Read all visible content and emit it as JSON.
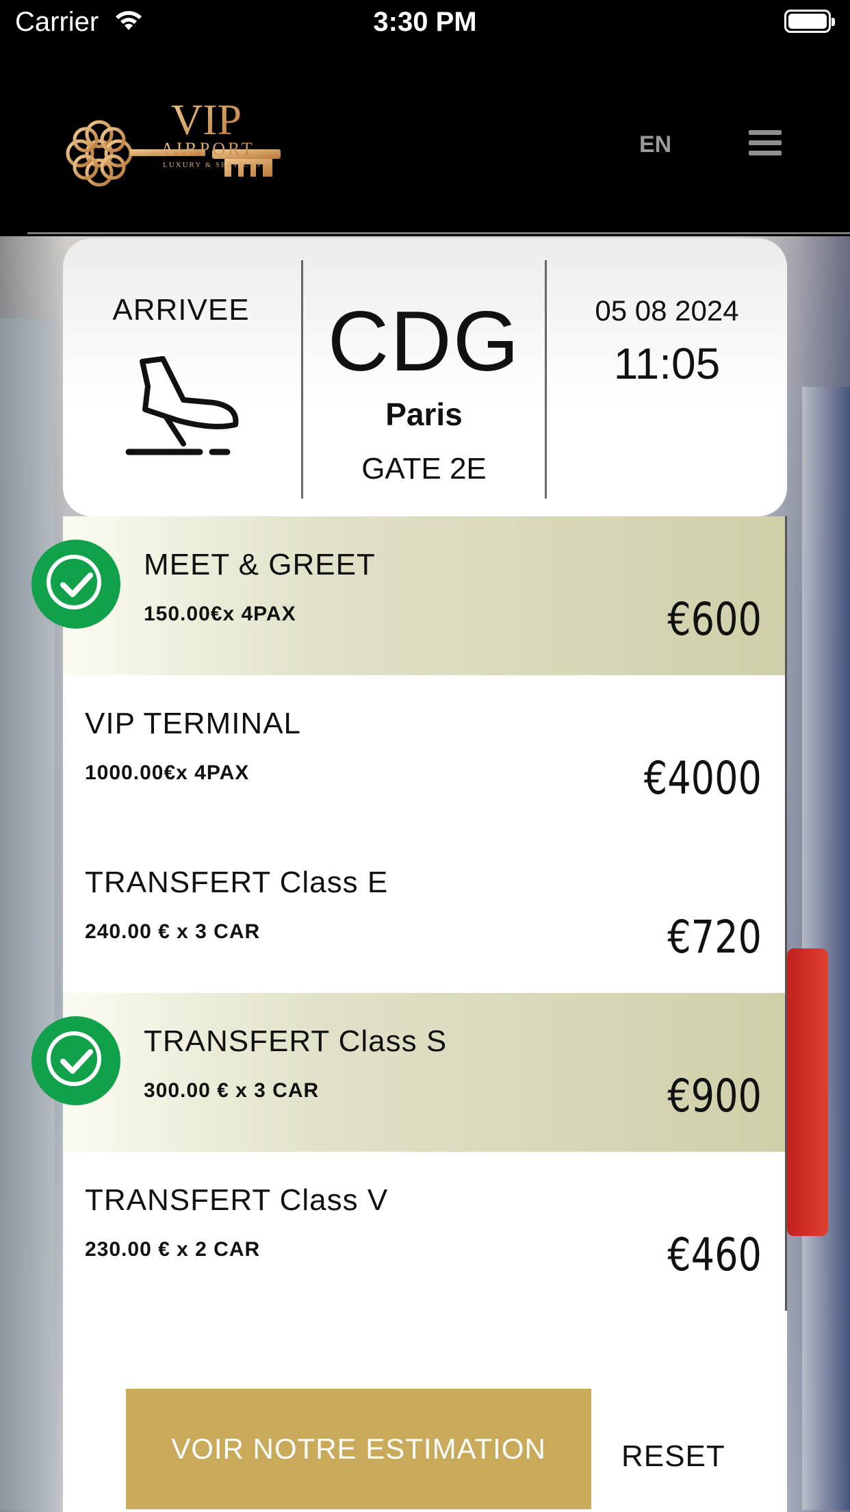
{
  "status_bar": {
    "carrier": "Carrier",
    "time": "3:30 PM"
  },
  "header": {
    "language": "EN"
  },
  "flight": {
    "direction": "ARRIVEE",
    "airport_code": "CDG",
    "city": "Paris",
    "gate": "GATE 2E",
    "date": "05 08 2024",
    "time": "11:05"
  },
  "services": [
    {
      "name": "MEET & GREET",
      "detail": "150.00€x 4PAX",
      "price": "€600",
      "selected": true
    },
    {
      "name": "VIP TERMINAL",
      "detail": "1000.00€x 4PAX",
      "price": "€4000",
      "selected": false
    },
    {
      "name": "TRANSFERT Class E",
      "detail": "240.00 € x 3 CAR",
      "price": "€720",
      "selected": false
    },
    {
      "name": "TRANSFERT Class S",
      "detail": "300.00 € x 3 CAR",
      "price": "€900",
      "selected": true
    },
    {
      "name": "TRANSFERT Class V",
      "detail": "230.00 € x 2 CAR",
      "price": "€460",
      "selected": false
    }
  ],
  "actions": {
    "estimate_label": "VOIR NOTRE ESTIMATION",
    "reset_label": "RESET"
  },
  "colors": {
    "accent_gold": "#c9aa5b",
    "check_green": "#11a14b",
    "selected_row": "#cfcfa9"
  },
  "icons": {
    "wifi": "wifi-icon",
    "battery": "battery-icon",
    "menu": "hamburger-menu-icon",
    "arrival": "plane-landing-icon",
    "check": "checkmark-icon"
  }
}
